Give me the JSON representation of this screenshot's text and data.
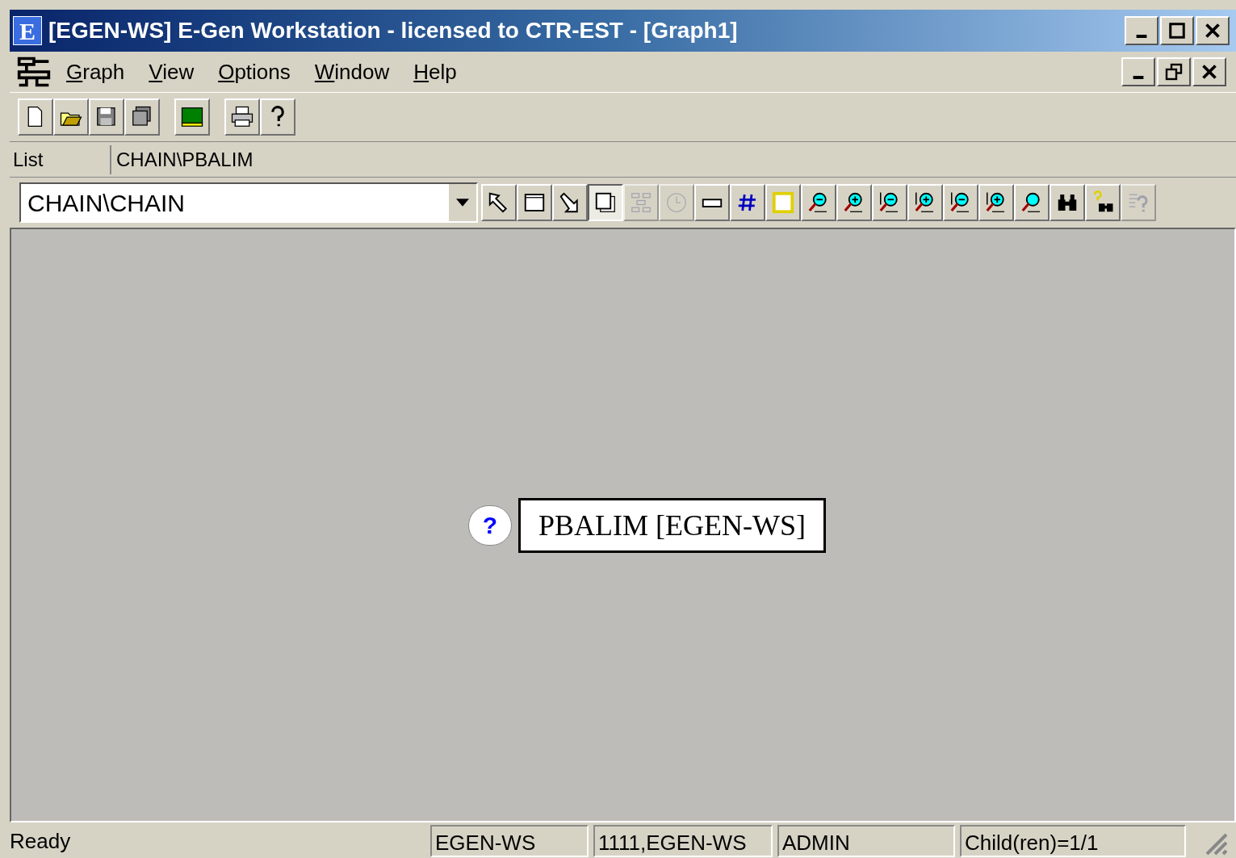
{
  "window": {
    "title": "[EGEN-WS] E-Gen Workstation - licensed to CTR-EST - [Graph1]",
    "app_icon_letter": "E"
  },
  "menu": [
    {
      "label": "Graph"
    },
    {
      "label": "View"
    },
    {
      "label": "Options"
    },
    {
      "label": "Window"
    },
    {
      "label": "Help"
    }
  ],
  "main_toolbar": [
    {
      "disabled": false
    },
    {
      "disabled": false
    },
    {
      "disabled": false
    },
    {
      "disabled": false
    },
    {
      "disabled": false
    },
    {
      "disabled": false
    },
    {
      "disabled": false
    }
  ],
  "list_bar": {
    "label": "List",
    "value": "CHAIN\\PBALIM"
  },
  "graph_toolbar": {
    "combo_value": "CHAIN\\CHAIN",
    "buttons": [
      {
        "pressed": false,
        "disabled": false
      },
      {
        "pressed": false,
        "disabled": false
      },
      {
        "pressed": false,
        "disabled": false
      },
      {
        "pressed": true,
        "disabled": false
      },
      {
        "pressed": false,
        "disabled": true
      },
      {
        "pressed": false,
        "disabled": true
      },
      {
        "pressed": false,
        "disabled": false
      },
      {
        "pressed": false,
        "disabled": false
      },
      {
        "pressed": false,
        "disabled": false
      },
      {
        "pressed": false,
        "disabled": false
      },
      {
        "pressed": false,
        "disabled": false
      },
      {
        "pressed": false,
        "disabled": false
      },
      {
        "pressed": false,
        "disabled": false
      },
      {
        "pressed": false,
        "disabled": false
      },
      {
        "pressed": false,
        "disabled": false
      },
      {
        "pressed": false,
        "disabled": false
      },
      {
        "pressed": false,
        "disabled": false
      },
      {
        "pressed": false,
        "disabled": false
      },
      {
        "pressed": false,
        "disabled": true
      }
    ]
  },
  "canvas": {
    "node": {
      "label": "PBALIM [EGEN-WS]",
      "help_mark": "?"
    }
  },
  "status_bar": [
    "Ready",
    "EGEN-WS",
    "1111,EGEN-WS",
    "ADMIN",
    "Child(ren)=1/1"
  ]
}
